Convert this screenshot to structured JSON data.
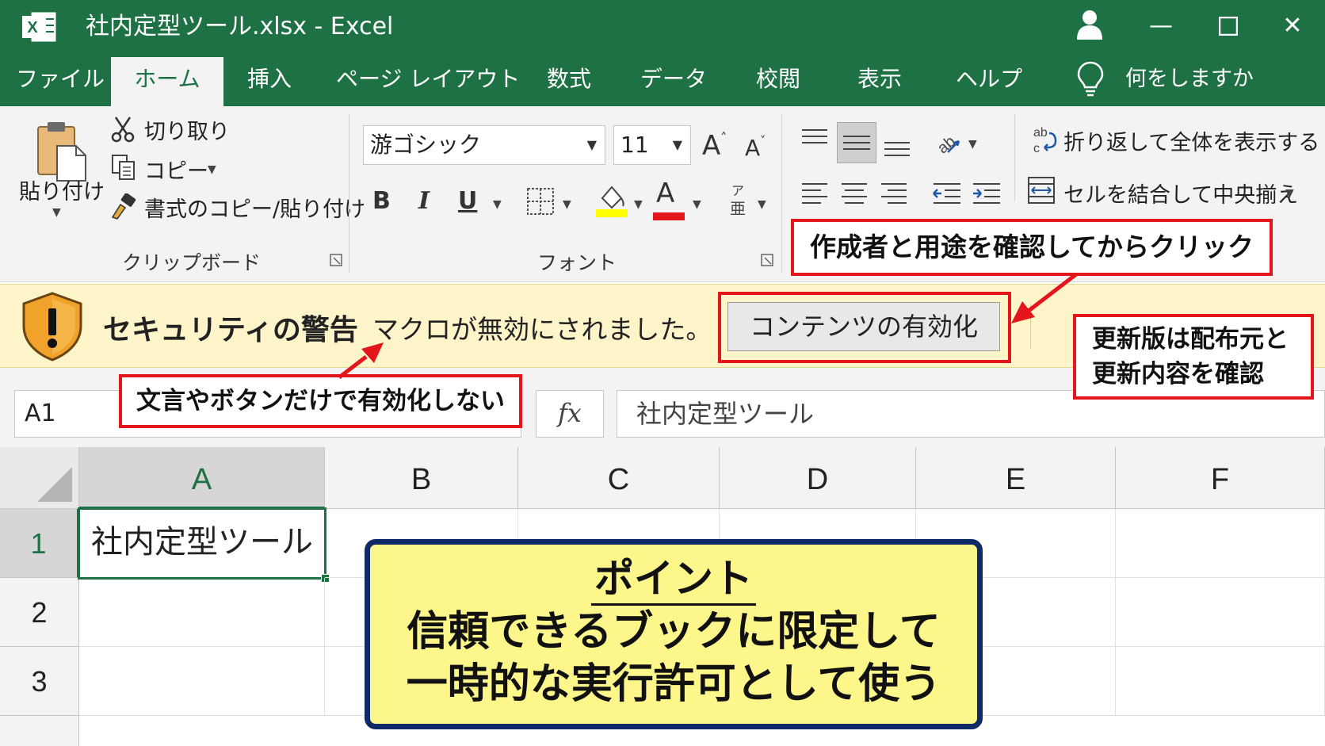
{
  "window": {
    "title": "社内定型ツール.xlsx - Excel"
  },
  "tabs": [
    "ファイル",
    "ホーム",
    "挿入",
    "ページ レイアウト",
    "数式",
    "データ",
    "校閲",
    "表示",
    "ヘルプ"
  ],
  "tell_me": "何をしますか",
  "ribbon": {
    "clipboard": {
      "paste": "貼り付け",
      "cut": "切り取り",
      "copy": "コピー",
      "format_painter": "書式のコピー/貼り付け",
      "label": "クリップボード"
    },
    "font": {
      "name": "游ゴシック",
      "size": "11",
      "label": "フォント",
      "bold": "B",
      "italic": "I",
      "underline": "U",
      "grow": "A",
      "shrink": "A",
      "font_color_glyph": "A",
      "highlight_color": "#ffff00",
      "font_color": "#e3161b"
    },
    "alignment": {
      "wrap_text": "折り返して全体を表示する",
      "merge_center": "セルを結合して中央揃え"
    }
  },
  "security_bar": {
    "title": "セキュリティの警告",
    "message": "マクロが無効にされました。",
    "button": "コンテンツの有効化"
  },
  "formula_bar": {
    "name_box": "A1",
    "fx": "fx",
    "value": "社内定型ツール"
  },
  "sheet": {
    "columns": [
      "A",
      "B",
      "C",
      "D",
      "E",
      "F"
    ],
    "rows": [
      "1",
      "2",
      "3"
    ],
    "active_cell_value": "社内定型ツール"
  },
  "annotations": {
    "confirm_author": "作成者と用途を確認してからクリック",
    "update_line1": "更新版は配布元と",
    "update_line2": "更新内容を確認",
    "not_by_text": "文言やボタンだけで有効化しない",
    "point_title": "ポイント",
    "point_line1": "信頼できるブックに限定して",
    "point_line2": "一時的な実行許可として使う"
  },
  "colors": {
    "excel_green": "#1e7145",
    "warning_bg": "#fdf5c9",
    "callout_red": "#e3161b",
    "point_bg": "#fdf68a",
    "point_border": "#102a68"
  }
}
